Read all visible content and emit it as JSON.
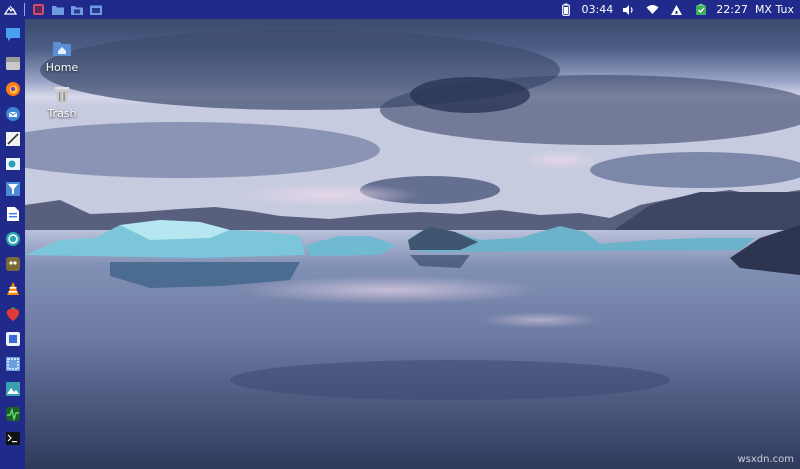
{
  "top_panel": {
    "battery_time": "03:44",
    "clock": "22:27",
    "user": "MX Tux",
    "launcher_icons": [
      "mx-logo-icon",
      "app-menu-icon",
      "folder-icon",
      "file-manager-icon",
      "window-icon"
    ],
    "tray_icons": [
      "battery-icon",
      "volume-icon",
      "wifi-icon",
      "update-icon",
      "package-icon"
    ]
  },
  "dock": {
    "items": [
      "chat-icon",
      "drive-icon",
      "firefox-icon",
      "thunderbird-icon",
      "text-editor-icon",
      "document-viewer-icon",
      "filter-icon",
      "writer-icon",
      "update-manager-icon",
      "conky-icon",
      "vlc-icon",
      "strawberry-icon",
      "package-installer-icon",
      "screenshot-icon",
      "image-viewer-icon",
      "system-monitor-icon",
      "terminal-icon"
    ]
  },
  "desktop": {
    "icons": [
      {
        "label": "Home",
        "icon": "home-folder-icon"
      },
      {
        "label": "Trash",
        "icon": "trash-icon"
      }
    ]
  },
  "watermark": "wsxdn.com",
  "colors": {
    "panel": "#1f2a8a",
    "sky_top": "#3a4a70",
    "horizon": "#cdd3e6",
    "ice": "#6fb8d0",
    "water": "#4a5a80"
  }
}
